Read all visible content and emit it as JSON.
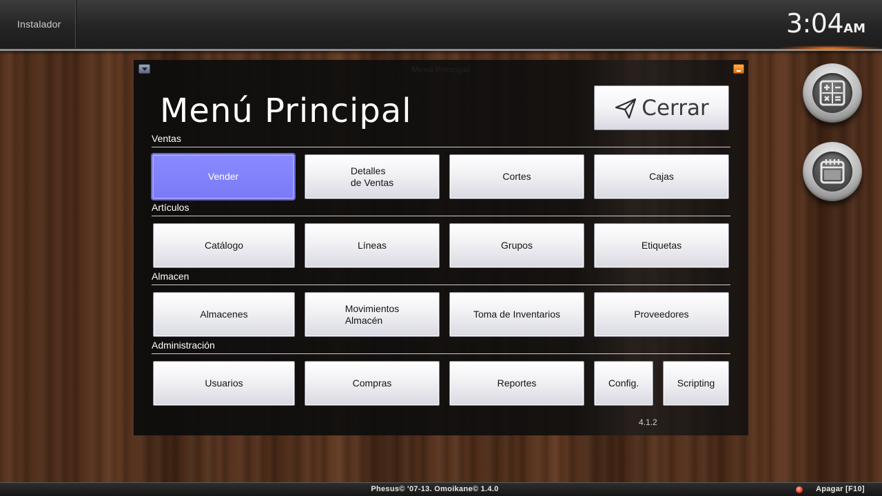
{
  "topbar": {
    "user_label": "Instalador",
    "clock_time": "3:04",
    "clock_ampm": "AM"
  },
  "window": {
    "title": "Menú Principal",
    "page_title": "Menú Principal",
    "close_label": "Cerrar",
    "version": "4.1.2"
  },
  "sections": {
    "ventas": {
      "label": "Ventas",
      "buttons": [
        "Vender",
        "Detalles\nde Ventas",
        "Cortes",
        "Cajas"
      ]
    },
    "articulos": {
      "label": "Artículos",
      "buttons": [
        "Catálogo",
        "Líneas",
        "Grupos",
        "Etiquetas"
      ]
    },
    "almacen": {
      "label": "Almacen",
      "buttons": [
        "Almacenes",
        "Movimientos\nAlmacén",
        "Toma de Inventarios",
        "Proveedores"
      ]
    },
    "administracion": {
      "label": "Administración",
      "buttons": [
        "Usuarios",
        "Compras",
        "Reportes",
        "Config.",
        "Scripting"
      ]
    }
  },
  "side_buttons": {
    "calculator_icon": "calculator-icon",
    "calendar_icon": "calendar-icon"
  },
  "statusbar": {
    "copyright": "Phesus© '07-13. Omoikane© 1.4.0",
    "power_label": "Apagar [F10]"
  },
  "colors": {
    "active_button": "#7f7ffb",
    "accent_orange": "#ff8c28"
  }
}
